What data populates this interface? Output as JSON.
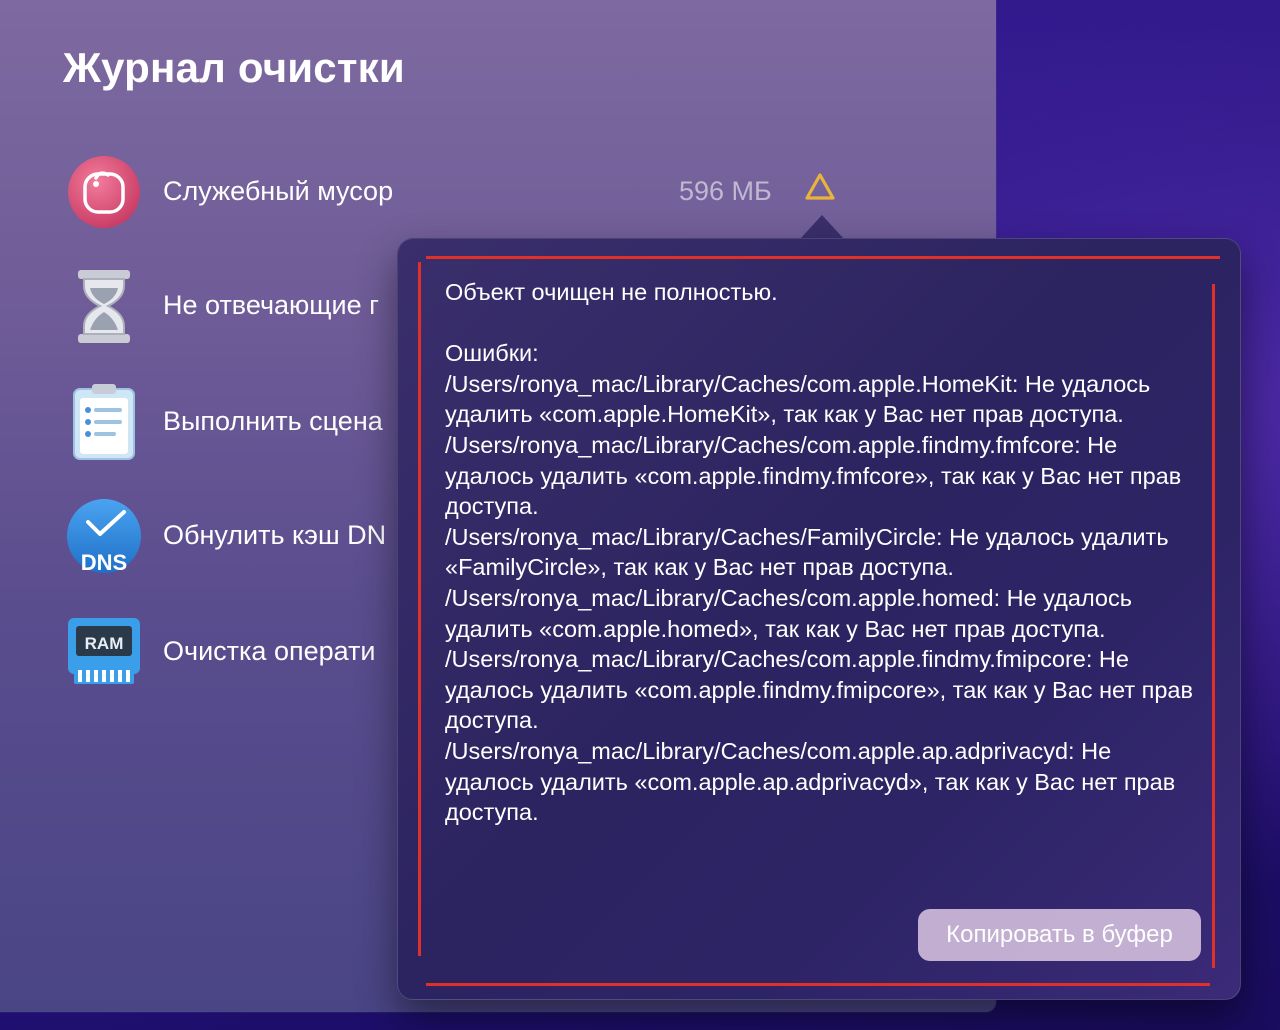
{
  "page": {
    "title": "Журнал очистки"
  },
  "items": [
    {
      "label": "Служебный мусор",
      "size": "596 МБ",
      "icon": "trash-icon"
    },
    {
      "label": "Не отвечающие г",
      "icon": "hourglass-icon"
    },
    {
      "label": "Выполнить сцена",
      "icon": "clipboard-icon"
    },
    {
      "label": "Обнулить кэш DN",
      "icon": "dns-icon",
      "icon_text": "DNS"
    },
    {
      "label": "Очистка операти",
      "icon": "ram-icon",
      "icon_text": "RAM"
    }
  ],
  "popover": {
    "heading": "Объект очищен не полностью.",
    "errors_label": "Ошибки:",
    "errors": [
      "/Users/ronya_mac/Library/Caches/com.apple.HomeKit: Не удалось удалить «com.apple.HomeKit», так как у Вас нет прав доступа.",
      "/Users/ronya_mac/Library/Caches/com.apple.findmy.fmfcore: Не удалось удалить «com.apple.findmy.fmfcore», так как у Вас нет прав доступа.",
      "/Users/ronya_mac/Library/Caches/FamilyCircle: Не удалось удалить «FamilyCircle», так как у Вас нет прав доступа.",
      "/Users/ronya_mac/Library/Caches/com.apple.homed: Не удалось удалить «com.apple.homed», так как у Вас нет прав доступа.",
      "/Users/ronya_mac/Library/Caches/com.apple.findmy.fmipcore: Не удалось удалить «com.apple.findmy.fmipcore», так как у Вас нет прав доступа.",
      "/Users/ronya_mac/Library/Caches/com.apple.ap.adprivacyd: Не удалось удалить «com.apple.ap.adprivacyd», так как у Вас нет прав доступа."
    ],
    "copy_button_label": "Копировать в буфер"
  },
  "colors": {
    "annotation": "#e0302a",
    "warning": "#e8b43a",
    "trash_icon": "#e8567a",
    "dns_icon": "#2f8ae0",
    "ram_icon": "#3a9ee8"
  }
}
